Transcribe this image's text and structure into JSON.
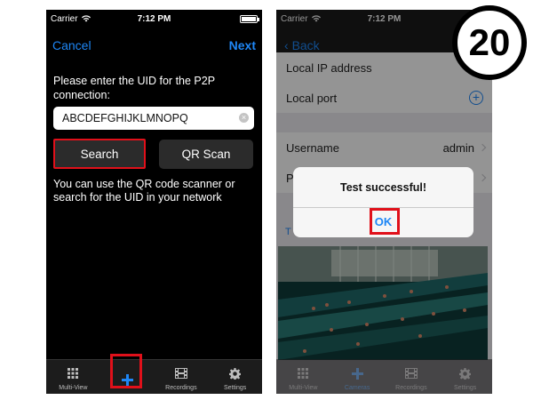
{
  "status_bar": {
    "carrier": "Carrier",
    "time": "7:12 PM"
  },
  "screen_left": {
    "cancel_label": "Cancel",
    "next_label": "Next",
    "prompt": "Please enter the UID for the P2P connection:",
    "uid_value": "ABCDEFGHIJKLMNOPQ",
    "search_label": "Search",
    "qr_label": "QR Scan",
    "hint": "You can use the QR code scanner or search for the UID in your network",
    "tabs": [
      {
        "label": "Multi-View",
        "icon": "grid-icon"
      },
      {
        "label": "",
        "icon": "plus-icon"
      },
      {
        "label": "Recordings",
        "icon": "film-icon"
      },
      {
        "label": "Settings",
        "icon": "gear-icon"
      }
    ]
  },
  "screen_right": {
    "back_label": "Back",
    "rows": [
      {
        "label": "Local IP address"
      },
      {
        "label": "Local port"
      },
      {
        "label": "Username",
        "value": "admin"
      },
      {
        "label": "P"
      }
    ],
    "link_label": "T",
    "alert": {
      "title": "Test successful!",
      "ok_label": "OK"
    },
    "tabs": [
      {
        "label": "Multi-View",
        "icon": "grid-icon"
      },
      {
        "label": "Cameras",
        "icon": "plus-icon"
      },
      {
        "label": "Recordings",
        "icon": "film-icon"
      },
      {
        "label": "Settings",
        "icon": "gear-icon"
      }
    ]
  },
  "step_number": "20",
  "colors": {
    "ios_blue": "#1e86f5",
    "highlight_red": "#e0101a"
  }
}
